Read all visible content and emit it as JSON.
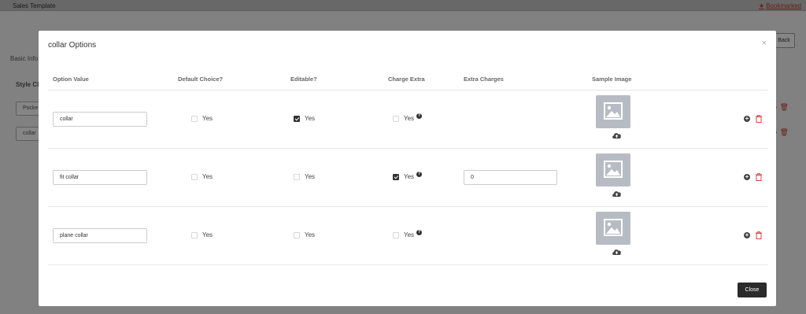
{
  "background": {
    "title": "Sales Template",
    "bookmark_star": "★",
    "bookmark": "Bookmarked",
    "back": "Back",
    "basic_info": "Basic Info",
    "style_label": "Style Cl",
    "fields": [
      "Pocke",
      "collar"
    ]
  },
  "modal": {
    "title": "collar Options",
    "close_x": "×",
    "close_label": "Close",
    "headers": {
      "option_value": "Option Value",
      "default_choice": "Default Choice?",
      "editable": "Editable?",
      "charge_extra": "Charge Extra",
      "extra_charges": "Extra Charges",
      "sample_image": "Sample Image"
    },
    "yes_label": "Yes",
    "help_icon": "?",
    "rows": [
      {
        "option_value": "collar",
        "default_choice": false,
        "editable": true,
        "charge_extra": false,
        "extra_charges": ""
      },
      {
        "option_value": "fit collar",
        "default_choice": false,
        "editable": false,
        "charge_extra": true,
        "extra_charges": "0"
      },
      {
        "option_value": "plane collar",
        "default_choice": false,
        "editable": false,
        "charge_extra": false,
        "extra_charges": ""
      }
    ]
  }
}
